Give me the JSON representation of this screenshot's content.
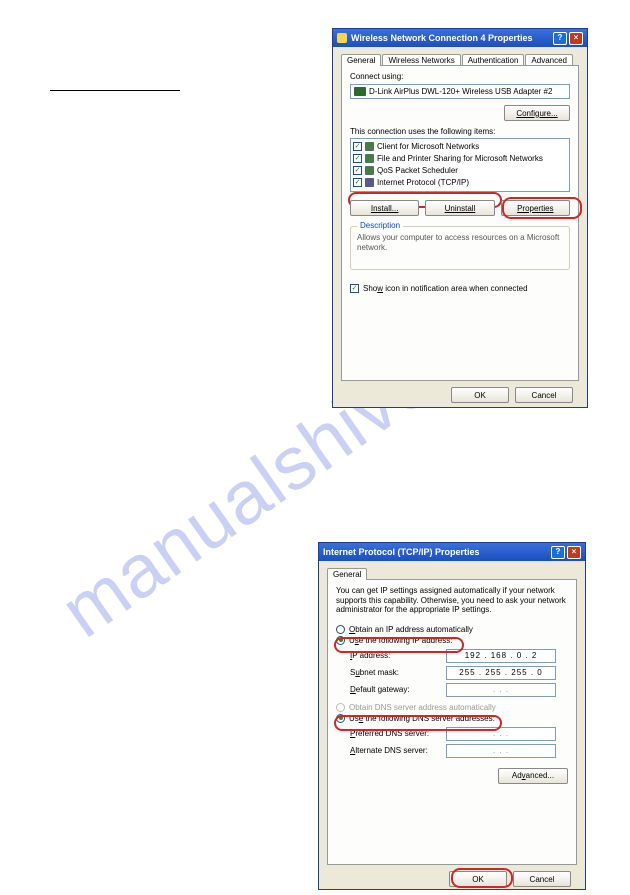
{
  "watermark": "manualshive.com",
  "dialog1": {
    "title": "Wireless Network Connection 4 Properties",
    "tabs": [
      "General",
      "Wireless Networks",
      "Authentication",
      "Advanced"
    ],
    "connect_using_label": "Connect using:",
    "adapter": "D-Link AirPlus DWL-120+ Wireless USB Adapter #2",
    "configure_btn": "Configure...",
    "items_label": "This connection uses the following items:",
    "items": [
      {
        "label": "Client for Microsoft Networks"
      },
      {
        "label": "File and Printer Sharing for Microsoft Networks"
      },
      {
        "label": "QoS Packet Scheduler"
      },
      {
        "label": "Internet Protocol (TCP/IP)"
      }
    ],
    "install_btn": "Install...",
    "uninstall_btn": "Uninstall",
    "properties_btn": "Properties",
    "desc_title": "Description",
    "desc_text": "Allows your computer to access resources on a Microsoft network.",
    "show_icon": "Show icon in notification area when connected",
    "ok": "OK",
    "cancel": "Cancel"
  },
  "dialog2": {
    "title": "Internet Protocol (TCP/IP) Properties",
    "tab": "General",
    "intro": "You can get IP settings assigned automatically if your network supports this capability. Otherwise, you need to ask your network administrator for the appropriate IP settings.",
    "radio_auto_ip": "Obtain an IP address automatically",
    "radio_use_ip": "Use the following IP address:",
    "ip_label": "IP address:",
    "ip_value": "192 . 168 .   0  .   2",
    "subnet_label": "Subnet mask:",
    "subnet_value": "255 . 255 . 255 .   0",
    "gateway_label": "Default gateway:",
    "gateway_value": " .       .       . ",
    "radio_auto_dns": "Obtain DNS server address automatically",
    "radio_use_dns": "Use the following DNS server addresses:",
    "pref_dns_label": "Preferred DNS server:",
    "alt_dns_label": "Alternate DNS server:",
    "dns_empty": " .       .       . ",
    "advanced_btn": "Advanced...",
    "ok": "OK",
    "cancel": "Cancel"
  }
}
